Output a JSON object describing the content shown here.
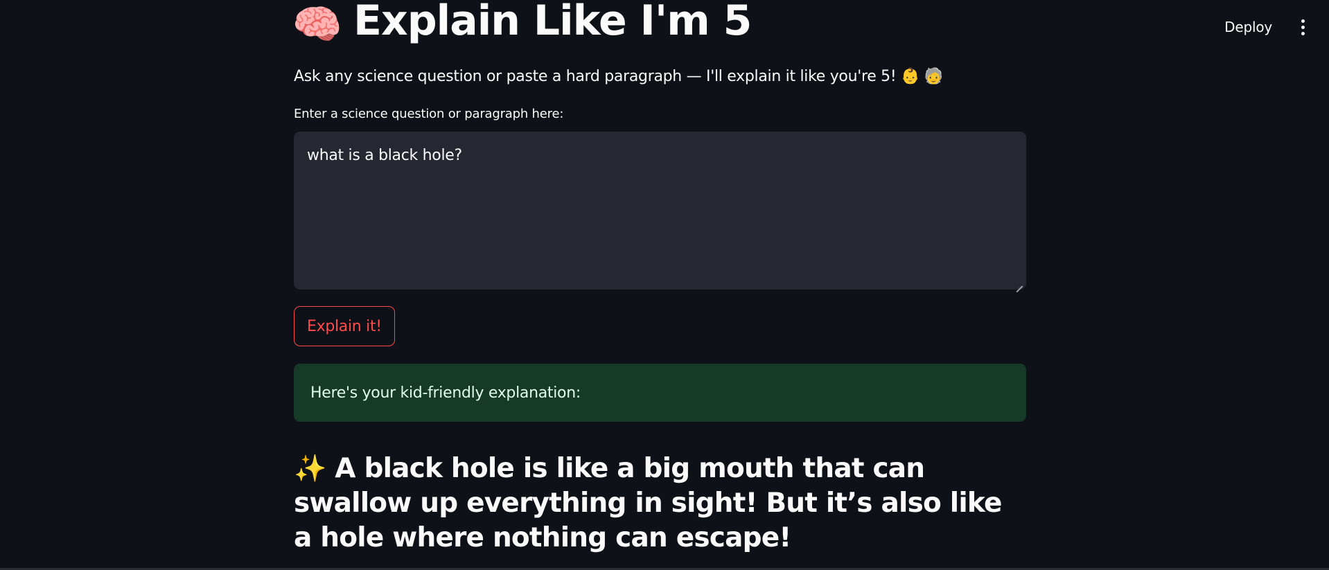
{
  "header": {
    "deploy_label": "Deploy",
    "menu_icon": "more-vertical-icon"
  },
  "main": {
    "title_emoji": "🧠",
    "title": "Explain Like I'm 5",
    "subtitle": "Ask any science question or paste a hard paragraph — I'll explain it like you're 5!",
    "subtitle_emojis": "👶 🧓",
    "input": {
      "label": "Enter a science question or paragraph here:",
      "value": "what is a black hole?",
      "placeholder": ""
    },
    "button_label": "Explain it!",
    "success_message": "Here's your kid-friendly explanation:",
    "answer_emoji": "✨",
    "answer": "A black hole is like a big mouth that can swallow up everything in sight! But it’s also like a hole where nothing can escape!"
  },
  "colors": {
    "background": "#0e1117",
    "input_bg": "#262730",
    "accent_red": "#ff4b4b",
    "success_bg": "#173928"
  }
}
